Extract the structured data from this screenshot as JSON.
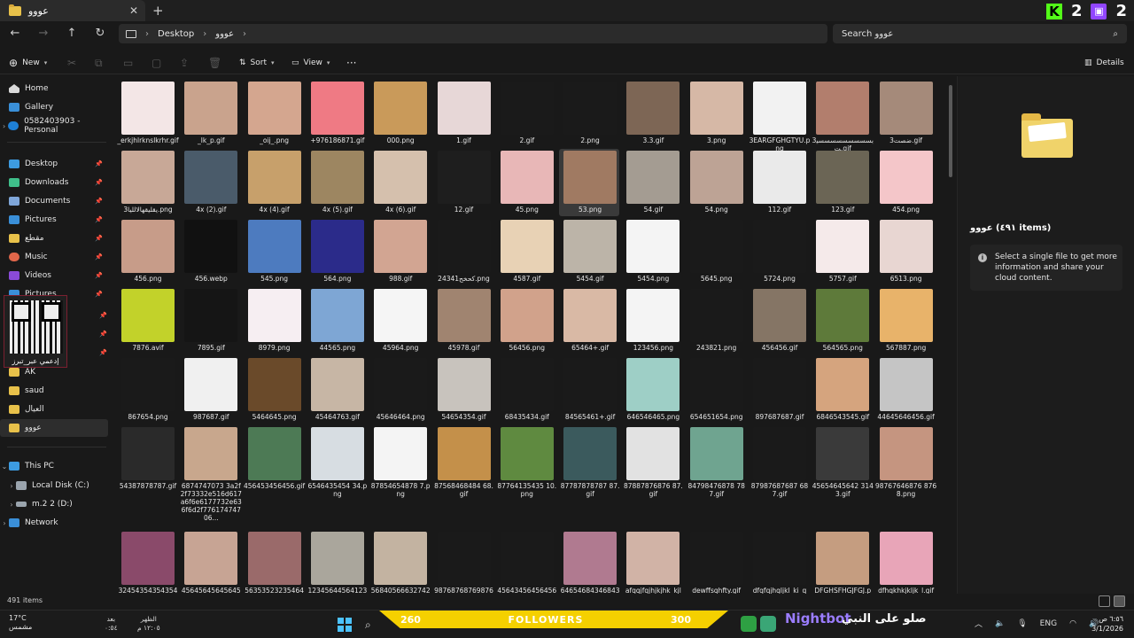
{
  "window": {
    "tab_title": "عووو",
    "tab_close": "✕",
    "tab_add": "+"
  },
  "stream_overlay": {
    "kick_count": "2",
    "twitch_count": "2",
    "kick_letter": "K"
  },
  "nav": {
    "back": "←",
    "forward": "→",
    "up": "↑",
    "refresh": "↻"
  },
  "breadcrumbs": [
    "Desktop",
    "عووو"
  ],
  "search": {
    "value": "Search عووو"
  },
  "toolbar": {
    "new": "New",
    "sort": "Sort",
    "view": "View",
    "more": "···",
    "details": "Details"
  },
  "sidebar": {
    "home": "Home",
    "gallery": "Gallery",
    "onedrive": "0582403903 - Personal",
    "quick": [
      "Desktop",
      "Downloads",
      "Documents",
      "Pictures",
      "مقطع",
      "Music",
      "Videos",
      "Pictures"
    ],
    "folders": [
      "AK",
      "saud",
      "العيال",
      "عووو"
    ],
    "this_pc": "This PC",
    "drives": [
      "Local Disk (C:)",
      "m.2 2 (D:)"
    ],
    "network": "Network"
  },
  "qr_overlay": {
    "label": "إدعمي عبر_تبرز"
  },
  "files": [
    {
      "name": "_erkjhlrknslkrhr.gif",
      "color": "#f3e6e6"
    },
    {
      "name": "_lk_p.gif",
      "color": "#c9a38d"
    },
    {
      "name": "_oij_.png",
      "color": "#d4a68f"
    },
    {
      "name": "+976186871.gif",
      "color": "#ef7a84"
    },
    {
      "name": "000.png",
      "color": "#c99a5a"
    },
    {
      "name": "1.gif",
      "color": "#e7d7d7"
    },
    {
      "name": "2.gif",
      "color": "#1a1a1a"
    },
    {
      "name": "2.png",
      "color": "#1a1a1a"
    },
    {
      "name": "3.3.gif",
      "color": "#7d6655"
    },
    {
      "name": "3.png",
      "color": "#d6b8a6"
    },
    {
      "name": "3EARGFGHGTYU.png",
      "color": "#f2f2f2"
    },
    {
      "name": "3بسسسسسسسسسيت.gif",
      "color": "#b27e6d"
    },
    {
      "name": "3ضصت.gif",
      "color": "#a58a7a"
    },
    {
      "name": "3يقليقهالالليا.png",
      "color": "#c8a897"
    },
    {
      "name": "4x (2).gif",
      "color": "#4a5b6a"
    },
    {
      "name": "4x (4).gif",
      "color": "#c7a06b"
    },
    {
      "name": "4x (5).gif",
      "color": "#9d8661"
    },
    {
      "name": "4x (6).gif",
      "color": "#d5c0ad"
    },
    {
      "name": "12.gif",
      "color": "#1e1e1e"
    },
    {
      "name": "45.png",
      "color": "#e8b7b7"
    },
    {
      "name": "53.png",
      "color": "#a07a62"
    },
    {
      "name": "54.gif",
      "color": "#a49c92"
    },
    {
      "name": "54.png",
      "color": "#bda395"
    },
    {
      "name": "112.gif",
      "color": "#eaeaea"
    },
    {
      "name": "123.gif",
      "color": "#6b6555"
    },
    {
      "name": "454.png",
      "color": "#f4c6c9"
    },
    {
      "name": "456.png",
      "color": "#c79c89"
    },
    {
      "name": "456.webp",
      "color": "#111111"
    },
    {
      "name": "545.png",
      "color": "#4d7bbf"
    },
    {
      "name": "564.png",
      "color": "#2b2b8a"
    },
    {
      "name": "988.gif",
      "color": "#d2a592"
    },
    {
      "name": "2كحخح4341.png",
      "color": "#1a1a1a"
    },
    {
      "name": "4587.gif",
      "color": "#e8d2b5"
    },
    {
      "name": "5454.gif",
      "color": "#bcb4a8"
    },
    {
      "name": "5454.png",
      "color": "#f4f4f4"
    },
    {
      "name": "5645.png",
      "color": "#1a1a1a"
    },
    {
      "name": "5724.png",
      "color": "#1a1a1a"
    },
    {
      "name": "5757.gif",
      "color": "#f5eaea"
    },
    {
      "name": "6513.png",
      "color": "#e8d6d2"
    },
    {
      "name": "7876.avif",
      "color": "#c2d22a"
    },
    {
      "name": "7895.gif",
      "color": "#151515"
    },
    {
      "name": "8979.png",
      "color": "#f6eef2"
    },
    {
      "name": "44565.png",
      "color": "#7ea6d4"
    },
    {
      "name": "45964.png",
      "color": "#f5f5f5"
    },
    {
      "name": "45978.gif",
      "color": "#a08470"
    },
    {
      "name": "56456.png",
      "color": "#d1a28b"
    },
    {
      "name": "65464+.gif",
      "color": "#d9b9a5"
    },
    {
      "name": "123456.png",
      "color": "#f4f4f4"
    },
    {
      "name": "243821.png",
      "color": "#1a1a1a"
    },
    {
      "name": "456456.gif",
      "color": "#857565"
    },
    {
      "name": "564565.png",
      "color": "#5e7a3a"
    },
    {
      "name": "567887.png",
      "color": "#e8b36a"
    },
    {
      "name": "867654.png",
      "color": "#1a1a1a"
    },
    {
      "name": "987687.gif",
      "color": "#f0f0f0"
    },
    {
      "name": "5464645.png",
      "color": "#6a4a2a"
    },
    {
      "name": "45464763.gif",
      "color": "#c7b6a5"
    },
    {
      "name": "45646464.png",
      "color": "#1a1a1a"
    },
    {
      "name": "54654354.gif",
      "color": "#c8c3bd"
    },
    {
      "name": "68435434.gif",
      "color": "#1a1a1a"
    },
    {
      "name": "84565461+.gif",
      "color": "#1a1a1a"
    },
    {
      "name": "646546465.png",
      "color": "#9ecfc6"
    },
    {
      "name": "654651654.png",
      "color": "#1a1a1a"
    },
    {
      "name": "897687687.gif",
      "color": "#1a1a1a"
    },
    {
      "name": "6846543545.gif",
      "color": "#d5a47e"
    },
    {
      "name": "44645646456.gif",
      "color": "#c5c5c5"
    },
    {
      "name": "54387878787.gif",
      "color": "#2a2a2a"
    },
    {
      "name": "6874747073 3a2f2f73332e516d617a6f6e6177732e636f6d2f77617474706...",
      "color": "#c8a78d"
    },
    {
      "name": "456453456456.gif",
      "color": "#4d7a55"
    },
    {
      "name": "6546435454 34.png",
      "color": "#d7dde2"
    },
    {
      "name": "87854654878 7.png",
      "color": "#f4f4f4"
    },
    {
      "name": "87568468484 68.gif",
      "color": "#c4904a"
    },
    {
      "name": "87764135435 10.png",
      "color": "#5f8a40"
    },
    {
      "name": "87787878787 87.gif",
      "color": "#3b5a5d"
    },
    {
      "name": "87887876876 87.gif",
      "color": "#e2e2e2"
    },
    {
      "name": "84798476878 787.gif",
      "color": "#6fa490"
    },
    {
      "name": "87987687687 687.gif",
      "color": "#1a1a1a"
    },
    {
      "name": "45654645642 3143.gif",
      "color": "#3a3a3a"
    },
    {
      "name": "98767646876 8768.png",
      "color": "#c59580"
    },
    {
      "name": "324543543543543",
      "color": "#8a4a6a"
    },
    {
      "name": "456456456456456",
      "color": "#c7a494"
    },
    {
      "name": "563535232354645",
      "color": "#9a6a6a"
    },
    {
      "name": "123456445641234",
      "color": "#aaa69c"
    },
    {
      "name": "568405666327429",
      "color": "#c3b3a1"
    },
    {
      "name": "987687687698768",
      "color": "#1a1a1a"
    },
    {
      "name": "456434564564564",
      "color": "#1a1a1a"
    },
    {
      "name": "646546843468435",
      "color": "#b07a90"
    },
    {
      "name": "afqqjfqjhjkjhk_kjl",
      "color": "#d1b3a6"
    },
    {
      "name": "dewffsqhfty.gif",
      "color": "#1a1a1a"
    },
    {
      "name": "dfqfqjhqljkl_ki_q",
      "color": "#1a1a1a"
    },
    {
      "name": "DFGHSFHGJFGJ.p",
      "color": "#c59d80"
    },
    {
      "name": "dfhqkhkjkljk_l.gif",
      "color": "#e8a5b8"
    }
  ],
  "details_pane": {
    "title": "عووو (٤٩١ items)",
    "info_text": "Select a single file to get more information and share your cloud content."
  },
  "status": {
    "count": "491 items"
  },
  "taskbar": {
    "temp": "17°C",
    "weather": "مشمس",
    "prayer1_label": "بعد",
    "prayer1_time": "٠:٥٤",
    "prayer2_label": "الظهر",
    "prayer2_time": "١٢:٠٥ م",
    "followers_left": "260",
    "followers_mid": "FOLLOWERS",
    "followers_right": "300",
    "nightbot": "Nightbot",
    "salawat": "صلو على النبي",
    "lang": "ENG",
    "time": "٦:٥٦ ص",
    "date": "3/1/2026"
  }
}
